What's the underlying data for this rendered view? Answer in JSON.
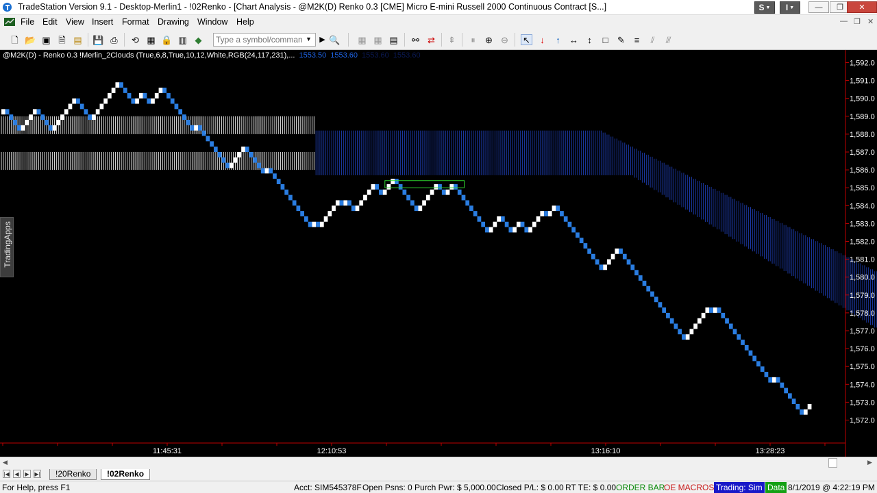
{
  "window": {
    "title": "TradeStation Version 9.1 - Desktop-Merlin1 - !02Renko - [Chart Analysis - @M2K(D) Renko 0.3 [CME] Micro E-mini Russell 2000 Continuous Contract [S...]",
    "buttons": {
      "s": "S",
      "i": "I",
      "minimize": "—",
      "restore": "❐",
      "close": "✕"
    }
  },
  "menu": {
    "items": [
      "File",
      "Edit",
      "View",
      "Insert",
      "Format",
      "Drawing",
      "Window",
      "Help"
    ]
  },
  "toolbar": {
    "symbol_placeholder": "Type a symbol/command"
  },
  "chart": {
    "header_text": "@M2K(D) - Renko 0.3  !Merlin_2Clouds (True,6,8,True,10,12,White,RGB(24,117,231),...",
    "header_values": [
      "1553.50",
      "1553.60",
      "1553.60",
      "1553.60"
    ],
    "side_tab": "TradingApps",
    "colors": {
      "up": "#ffffff",
      "down": "#2a7de1",
      "cloud_white": "#ffffff",
      "cloud_blue": "#1e3fb4",
      "axis": "#c00000",
      "box": "#2fd82f"
    }
  },
  "chart_data": {
    "type": "renko",
    "brick_size": 0.3,
    "y_ticks": [
      "1,592.0",
      "1,591.0",
      "1,590.0",
      "1,589.0",
      "1,588.0",
      "1,587.0",
      "1,586.0",
      "1,585.0",
      "1,584.0",
      "1,583.0",
      "1,582.0",
      "1,581.0",
      "1,580.0",
      "1,579.0",
      "1,578.0",
      "1,577.0",
      "1,576.0",
      "1,575.0",
      "1,574.0",
      "1,573.0",
      "1,572.0"
    ],
    "ylim": [
      1571.5,
      1592.5
    ],
    "x_ticks": [
      "11:45:31",
      "12:10:53",
      "13:16:10",
      "13:28:23"
    ],
    "closes": [
      1589.4,
      1589.1,
      1588.8,
      1588.5,
      1588.2,
      1588.5,
      1588.8,
      1589.1,
      1589.4,
      1589.1,
      1588.8,
      1588.5,
      1588.2,
      1588.5,
      1588.8,
      1589.1,
      1589.4,
      1589.7,
      1590.0,
      1589.7,
      1589.4,
      1589.1,
      1588.8,
      1589.1,
      1589.4,
      1589.7,
      1590.0,
      1590.3,
      1590.6,
      1590.9,
      1590.6,
      1590.3,
      1590.0,
      1589.7,
      1590.0,
      1590.3,
      1590.0,
      1589.7,
      1590.0,
      1590.3,
      1590.6,
      1590.3,
      1590.0,
      1589.7,
      1589.4,
      1589.1,
      1588.8,
      1588.5,
      1588.2,
      1588.5,
      1588.2,
      1587.9,
      1587.6,
      1587.3,
      1587.0,
      1586.7,
      1586.4,
      1586.1,
      1586.4,
      1586.7,
      1587.0,
      1587.3,
      1587.0,
      1586.7,
      1586.4,
      1586.1,
      1585.8,
      1586.1,
      1585.8,
      1585.5,
      1585.2,
      1584.9,
      1584.6,
      1584.3,
      1584.0,
      1583.7,
      1583.4,
      1583.1,
      1582.8,
      1583.1,
      1582.8,
      1583.1,
      1583.4,
      1583.7,
      1584.0,
      1584.3,
      1584.0,
      1584.3,
      1584.0,
      1583.7,
      1584.0,
      1584.3,
      1584.6,
      1584.9,
      1585.2,
      1584.9,
      1584.6,
      1584.9,
      1585.2,
      1585.5,
      1585.2,
      1584.9,
      1584.6,
      1584.3,
      1584.0,
      1583.7,
      1584.0,
      1584.3,
      1584.6,
      1584.9,
      1585.2,
      1584.9,
      1584.6,
      1584.9,
      1585.2,
      1584.9,
      1584.6,
      1584.3,
      1584.0,
      1583.7,
      1583.4,
      1583.1,
      1582.8,
      1582.5,
      1582.8,
      1583.1,
      1583.4,
      1583.1,
      1582.8,
      1582.5,
      1582.8,
      1583.1,
      1582.8,
      1582.5,
      1582.8,
      1583.1,
      1583.4,
      1583.7,
      1583.4,
      1583.7,
      1584.0,
      1583.7,
      1583.4,
      1583.1,
      1582.8,
      1582.5,
      1582.2,
      1581.9,
      1581.6,
      1581.3,
      1581.0,
      1580.7,
      1580.4,
      1580.7,
      1581.0,
      1581.3,
      1581.6,
      1581.3,
      1581.0,
      1580.7,
      1580.4,
      1580.1,
      1579.8,
      1579.5,
      1579.2,
      1578.9,
      1578.6,
      1578.3,
      1578.0,
      1577.7,
      1577.4,
      1577.1,
      1576.8,
      1576.5,
      1576.8,
      1577.1,
      1577.4,
      1577.7,
      1578.0,
      1578.3,
      1578.0,
      1578.3,
      1578.0,
      1577.7,
      1577.4,
      1577.1,
      1576.8,
      1576.5,
      1576.2,
      1575.9,
      1575.6,
      1575.3,
      1575.0,
      1574.7,
      1574.4,
      1574.1,
      1574.4,
      1574.1,
      1573.8,
      1573.5,
      1573.2,
      1572.9,
      1572.6,
      1572.3,
      1572.6,
      1572.9
    ],
    "white_cloud": [
      {
        "from": 0,
        "to": 80,
        "top": 1589.0,
        "bottom": 1588.0
      },
      {
        "from": 0,
        "to": 80,
        "top": 1587.0,
        "bottom": 1586.0
      }
    ],
    "blue_cloud": [
      {
        "from": 80,
        "to": 240,
        "top": 1588.5,
        "bottom": 1583.0
      }
    ],
    "highlight_box": {
      "from": 97,
      "to": 117,
      "top": 1585.4,
      "bottom": 1585.0
    }
  },
  "tabs": {
    "items": [
      "!20Renko",
      "!02Renko"
    ],
    "active": 1
  },
  "status": {
    "help": "For Help, press F1",
    "acct": "Acct: SIM545378F",
    "open_psns": "Open Psns: 0",
    "purch_pwr": "Purch Pwr: $ 5,000.00",
    "closed_pl": "Closed P/L: $ 0.00",
    "rt_te": "RT TE: $ 0.00",
    "order_bar": "ORDER BAR",
    "oe_macros": "OE MACROS",
    "trading": "Trading: Sim",
    "data": "Data",
    "datetime": "8/1/2019 @ 4:22:19 PM",
    "colors": {
      "order_bar": "#0a8a0a",
      "oe_macros": "#c81818",
      "trading_bg": "#1818c8",
      "data_bg": "#14a014"
    }
  }
}
